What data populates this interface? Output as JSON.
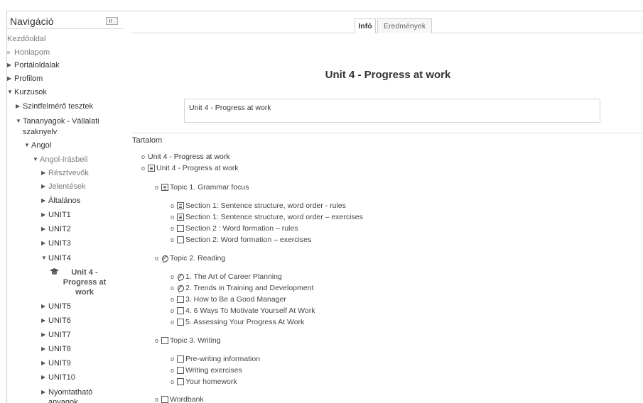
{
  "sidebar": {
    "title": "Navigáció",
    "items": {
      "home": "Kezdőoldal",
      "mypage": "Honlapom",
      "site_pages": "Portáloldalak",
      "profile": "Profilom",
      "courses": "Kurzusok",
      "placement_tests": "Szintfelmérő tesztek",
      "materials_line1": "Tananyagok - Vállalati",
      "materials_line2": "szaknyelv",
      "english": "Angol",
      "english_written": "Angol-írásbeli",
      "participants": "Résztvevők",
      "reports": "Jelentések",
      "general": "Általános",
      "unit1": "UNIT1",
      "unit2": "UNIT2",
      "unit3": "UNIT3",
      "unit4": "UNIT4",
      "active_unit": "Unit 4 - Progress at work",
      "unit5": "UNIT5",
      "unit6": "UNIT6",
      "unit7": "UNIT7",
      "unit8": "UNIT8",
      "unit9": "UNIT9",
      "unit10": "UNIT10",
      "printable_line1": "Nyomtatható",
      "printable_line2": "anyagok"
    }
  },
  "tabs": {
    "info": "Infó",
    "results": "Eredmények"
  },
  "main": {
    "title": "Unit 4 - Progress at work",
    "summary": "Unit 4 - Progress at work",
    "contents_label": "Tartalom"
  },
  "toc": {
    "root1": "Unit 4 - Progress at work",
    "root2": "Unit 4 - Progress at work",
    "topic1": "Topic 1. Grammar focus",
    "t1s1": "Section 1: Sentence structure, word order - rules",
    "t1s2": "Section 1: Sentence structure, word order – exercises",
    "t1s3": "Section 2 : Word formation – rules",
    "t1s4": "Section 2: Word formation – exercises",
    "topic2": "Topic 2. Reading",
    "t2s1": "1. The Art of Career Planning",
    "t2s2": "2. Trends in Training and Development",
    "t2s3": "3. How to Be a Good Manager",
    "t2s4": "4. 6 Ways To Motivate Yourself At Work",
    "t2s5": "5. Assessing Your Progress At Work",
    "topic3": "Topic 3. Writing",
    "t3s1": "Pre-writing information",
    "t3s2": "Writing exercises",
    "t3s3": "Your homework",
    "wordbank": "Wordbank"
  },
  "icons": {
    "arrow_closed": "triangle-right",
    "arrow_open": "triangle-down",
    "book": "book-icon",
    "quiz": "quiz-icon",
    "page": "page-icon",
    "course": "mortarboard-icon"
  }
}
